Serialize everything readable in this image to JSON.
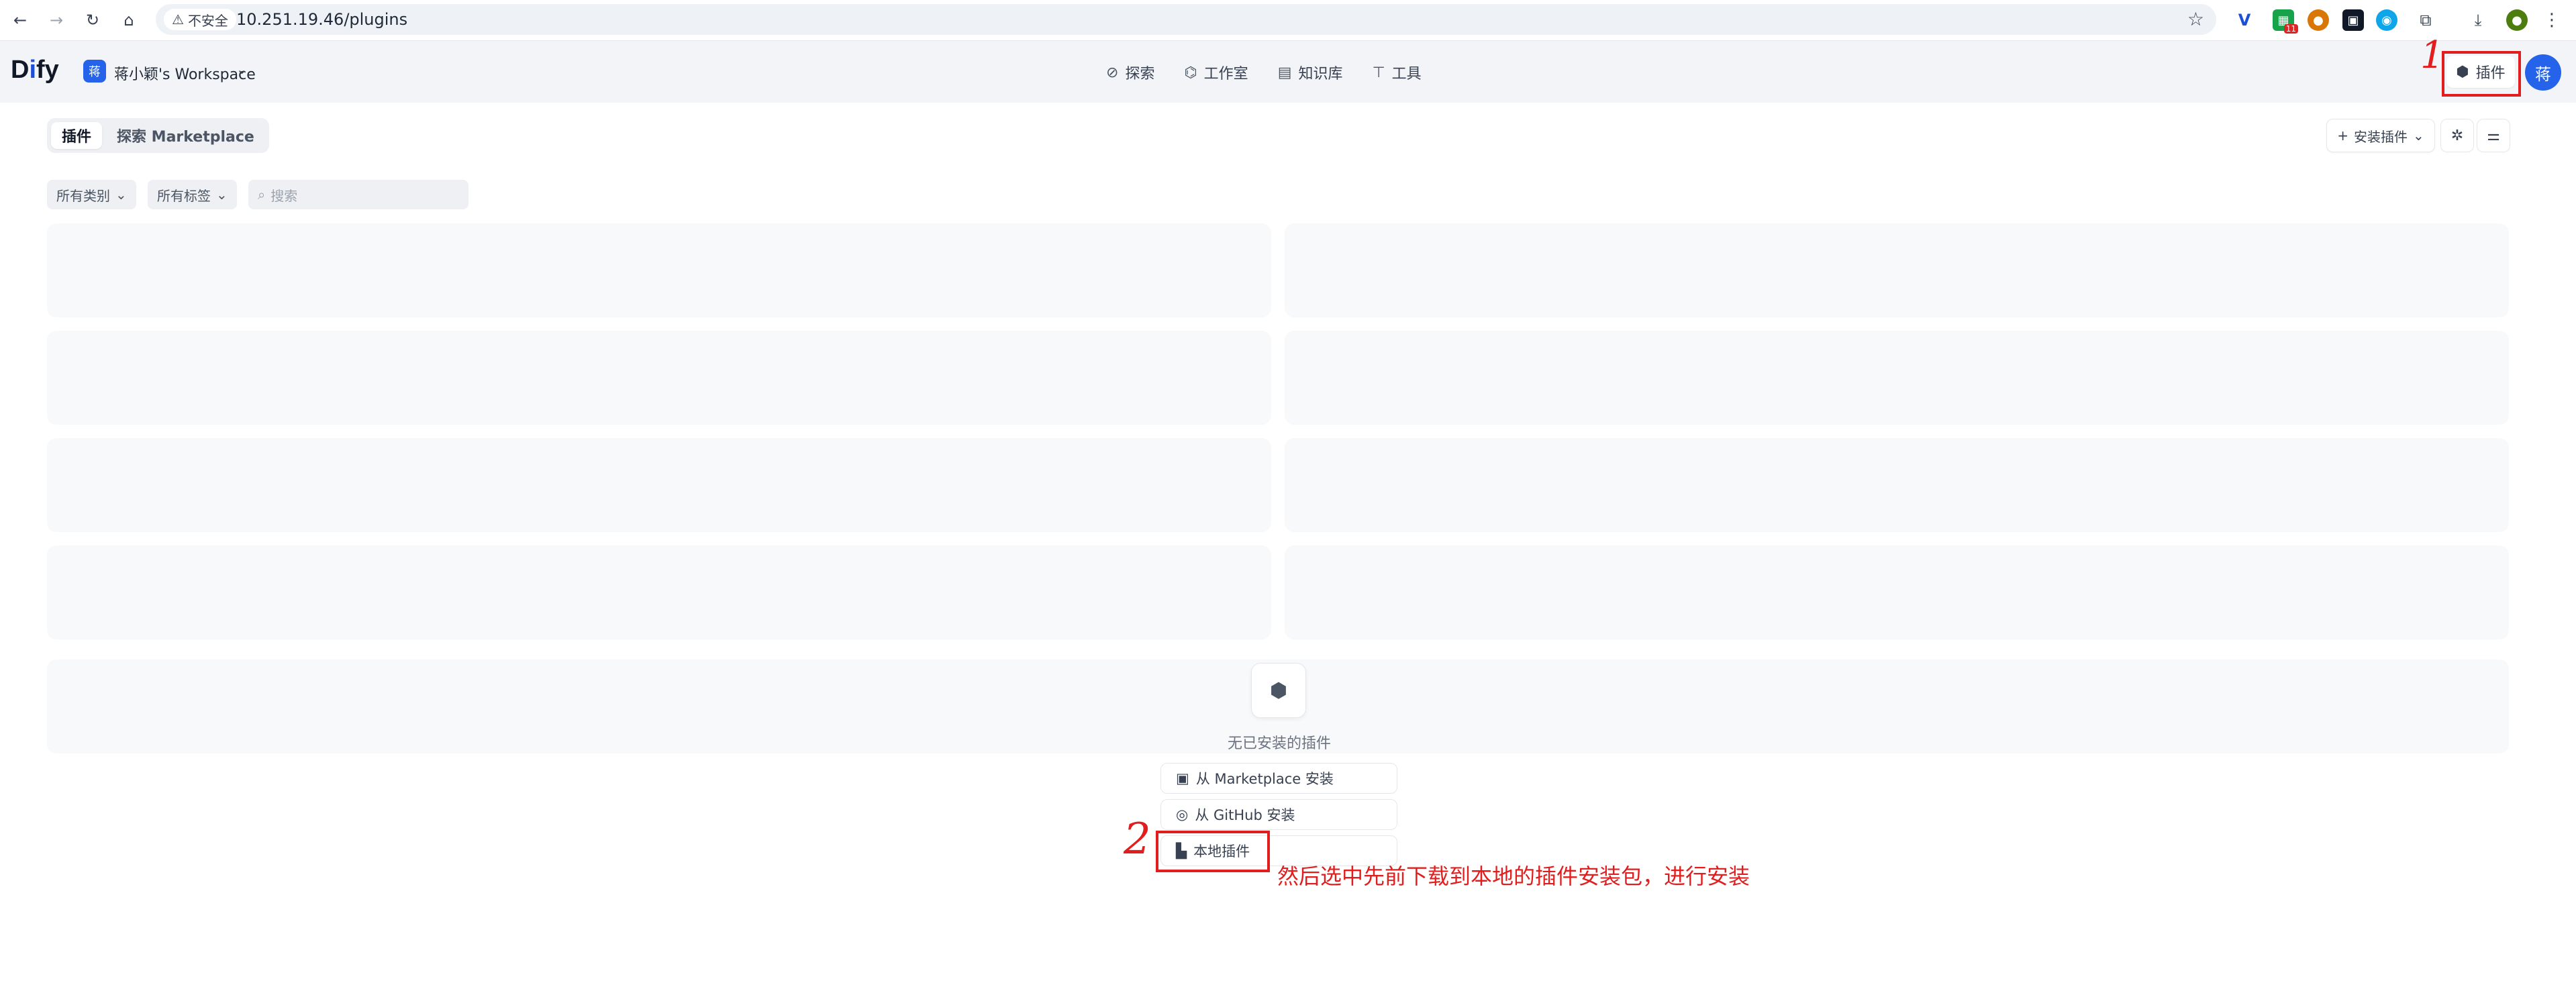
{
  "browser": {
    "security_label": "不安全",
    "url": "10.251.19.46/plugins",
    "extension_badge": "11"
  },
  "header": {
    "logo_text": "Dify",
    "workspace_avatar": "蒋",
    "workspace_name": "蒋小颖's Workspace",
    "nav": [
      {
        "label": "探索",
        "icon": "explore-icon"
      },
      {
        "label": "工作室",
        "icon": "studio-icon"
      },
      {
        "label": "知识库",
        "icon": "knowledge-icon"
      },
      {
        "label": "工具",
        "icon": "tools-icon"
      }
    ],
    "plugins_label": "插件",
    "user_avatar": "蒋"
  },
  "tabs": [
    {
      "label": "插件",
      "active": true
    },
    {
      "label": "探索 Marketplace",
      "active": false
    }
  ],
  "toolbar": {
    "install_label": "安装插件"
  },
  "filters": {
    "category_label": "所有类别",
    "tag_label": "所有标签",
    "search_placeholder": "搜索"
  },
  "empty_state": {
    "text": "无已安装的插件",
    "options": [
      {
        "label": "从 Marketplace 安装",
        "icon": "marketplace-icon"
      },
      {
        "label": "从 GitHub 安装",
        "icon": "github-icon"
      },
      {
        "label": "本地插件",
        "icon": "file-icon"
      }
    ]
  },
  "annotations": {
    "step1": "1",
    "step2": "2",
    "note": "然后选中先前下载到本地的插件安装包，进行安装"
  },
  "colors": {
    "accent": "#2563eb",
    "annotation": "#e11d1d"
  }
}
